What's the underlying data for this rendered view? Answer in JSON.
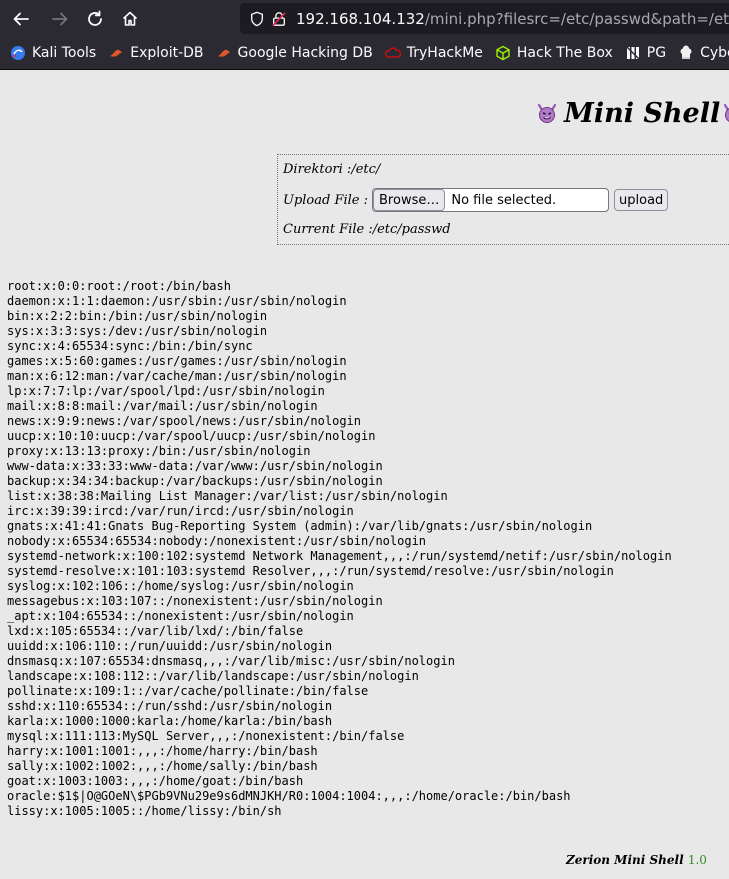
{
  "browser": {
    "url_host": "192.168.104.132",
    "url_rest": "/mini.php?filesrc=/etc/passwd&path=/etc",
    "bookmarks": [
      {
        "label": "Kali Tools",
        "icon": "kali-icon"
      },
      {
        "label": "Exploit-DB",
        "icon": "exploit-db-icon"
      },
      {
        "label": "Google Hacking DB",
        "icon": "ghdb-icon"
      },
      {
        "label": "TryHackMe",
        "icon": "tryhackme-icon"
      },
      {
        "label": "Hack The Box",
        "icon": "htb-cube-icon"
      },
      {
        "label": "PG",
        "icon": "pg-icon"
      },
      {
        "label": "CyberChef",
        "icon": "cyberchef-icon"
      }
    ]
  },
  "shell": {
    "title": "Mini Shell",
    "directory_label": "Direktori : ",
    "directory_value": "/etc/",
    "upload_label": "Upload File : ",
    "browse_label": "Browse…",
    "no_file_label": "No file selected.",
    "upload_button": "upload",
    "current_file_label": "Current File : ",
    "current_file_value": "/etc/passwd",
    "file_lines": [
      "root:x:0:0:root:/root:/bin/bash",
      "daemon:x:1:1:daemon:/usr/sbin:/usr/sbin/nologin",
      "bin:x:2:2:bin:/bin:/usr/sbin/nologin",
      "sys:x:3:3:sys:/dev:/usr/sbin/nologin",
      "sync:x:4:65534:sync:/bin:/bin/sync",
      "games:x:5:60:games:/usr/games:/usr/sbin/nologin",
      "man:x:6:12:man:/var/cache/man:/usr/sbin/nologin",
      "lp:x:7:7:lp:/var/spool/lpd:/usr/sbin/nologin",
      "mail:x:8:8:mail:/var/mail:/usr/sbin/nologin",
      "news:x:9:9:news:/var/spool/news:/usr/sbin/nologin",
      "uucp:x:10:10:uucp:/var/spool/uucp:/usr/sbin/nologin",
      "proxy:x:13:13:proxy:/bin:/usr/sbin/nologin",
      "www-data:x:33:33:www-data:/var/www:/usr/sbin/nologin",
      "backup:x:34:34:backup:/var/backups:/usr/sbin/nologin",
      "list:x:38:38:Mailing List Manager:/var/list:/usr/sbin/nologin",
      "irc:x:39:39:ircd:/var/run/ircd:/usr/sbin/nologin",
      "gnats:x:41:41:Gnats Bug-Reporting System (admin):/var/lib/gnats:/usr/sbin/nologin",
      "nobody:x:65534:65534:nobody:/nonexistent:/usr/sbin/nologin",
      "systemd-network:x:100:102:systemd Network Management,,,:/run/systemd/netif:/usr/sbin/nologin",
      "systemd-resolve:x:101:103:systemd Resolver,,,:/run/systemd/resolve:/usr/sbin/nologin",
      "syslog:x:102:106::/home/syslog:/usr/sbin/nologin",
      "messagebus:x:103:107::/nonexistent:/usr/sbin/nologin",
      "_apt:x:104:65534::/nonexistent:/usr/sbin/nologin",
      "lxd:x:105:65534::/var/lib/lxd/:/bin/false",
      "uuidd:x:106:110::/run/uuidd:/usr/sbin/nologin",
      "dnsmasq:x:107:65534:dnsmasq,,,:/var/lib/misc:/usr/sbin/nologin",
      "landscape:x:108:112::/var/lib/landscape:/usr/sbin/nologin",
      "pollinate:x:109:1::/var/cache/pollinate:/bin/false",
      "sshd:x:110:65534::/run/sshd:/usr/sbin/nologin",
      "karla:x:1000:1000:karla:/home/karla:/bin/bash",
      "mysql:x:111:113:MySQL Server,,,:/nonexistent:/bin/false",
      "harry:x:1001:1001:,,,:/home/harry:/bin/bash",
      "sally:x:1002:1002:,,,:/home/sally:/bin/bash",
      "goat:x:1003:1003:,,,:/home/goat:/bin/bash",
      "oracle:$1$|O@GOeN\\$PGb9VNu29e9s6dMNJKH/R0:1004:1004:,,,:/home/oracle:/bin/bash",
      "lissy:x:1005:1005::/home/lissy:/bin/sh"
    ],
    "footer_name": "Zerion Mini Shell",
    "footer_version": "1.0"
  },
  "colors": {
    "chrome_bg": "#2b2a33",
    "urlbar_bg": "#1c1b22",
    "page_bg": "#e8e8e8",
    "version_green": "#2e8b22",
    "devil_purple": "#9b59b6"
  }
}
